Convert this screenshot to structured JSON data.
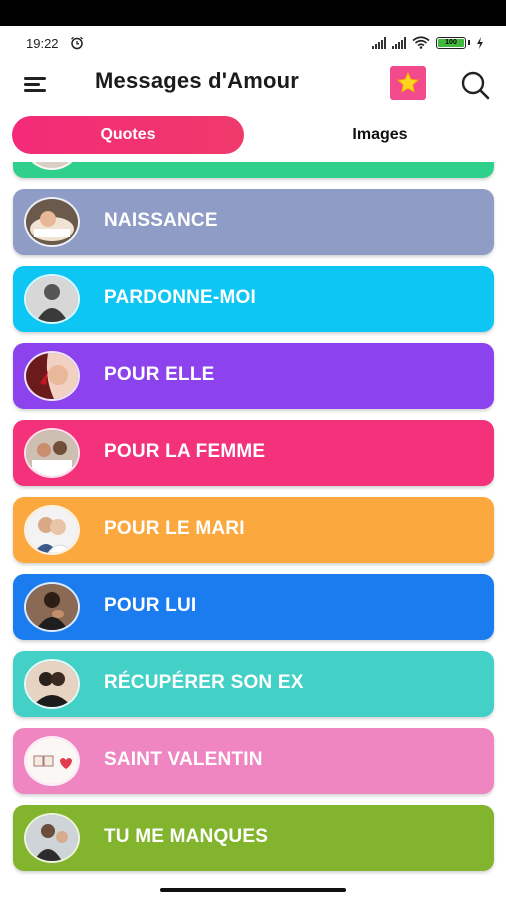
{
  "status_bar": {
    "time": "19:22",
    "battery": "100"
  },
  "app_bar": {
    "title": "Messages d'Amour"
  },
  "tabs": [
    {
      "label": "Quotes",
      "selected": true
    },
    {
      "label": "Images",
      "selected": false
    }
  ],
  "categories": [
    {
      "label": "",
      "color": "#2fd08c"
    },
    {
      "label": "NAISSANCE",
      "color": "#8e9cc6"
    },
    {
      "label": "PARDONNE-MOI",
      "color": "#0ec6f3"
    },
    {
      "label": "POUR ELLE",
      "color": "#8c43ee"
    },
    {
      "label": "POUR LA FEMME",
      "color": "#f4327c"
    },
    {
      "label": "POUR LE MARI",
      "color": "#fba83e"
    },
    {
      "label": "POUR LUI",
      "color": "#1b7cf0"
    },
    {
      "label": "RÉCUPÉRER SON EX",
      "color": "#43d0c6"
    },
    {
      "label": "SAINT VALENTIN",
      "color": "#ef86c2"
    },
    {
      "label": "TU ME MANQUES",
      "color": "#82b52d"
    }
  ]
}
